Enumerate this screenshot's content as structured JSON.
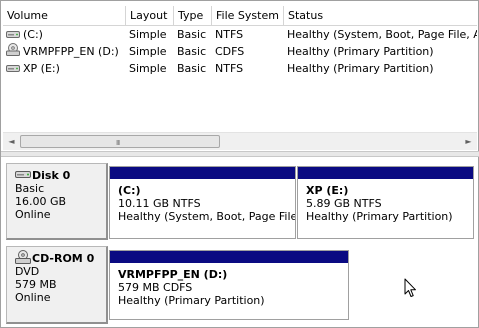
{
  "columns": [
    "Volume",
    "Layout",
    "Type",
    "File System",
    "Status"
  ],
  "volumes": [
    {
      "icon": "hard-disk-icon",
      "name": "(C:)",
      "layout": "Simple",
      "type": "Basic",
      "fs": "NTFS",
      "status": "Healthy (System, Boot, Page File, Ac"
    },
    {
      "icon": "cd-drive-icon",
      "name": "VRMPFPP_EN (D:)",
      "layout": "Simple",
      "type": "Basic",
      "fs": "CDFS",
      "status": "Healthy (Primary Partition)"
    },
    {
      "icon": "hard-disk-icon",
      "name": "XP (E:)",
      "layout": "Simple",
      "type": "Basic",
      "fs": "NTFS",
      "status": "Healthy (Primary Partition)"
    }
  ],
  "disks": [
    {
      "name": "Disk 0",
      "kind": "Basic",
      "size": "16.00 GB",
      "state": "Online",
      "partitions": [
        {
          "label": "(C:)",
          "size": "10.11 GB NTFS",
          "status": "Healthy (System, Boot, Page File,"
        },
        {
          "label": "XP  (E:)",
          "size": "5.89 GB NTFS",
          "status": "Healthy (Primary Partition)"
        }
      ]
    },
    {
      "name": "CD-ROM 0",
      "kind": "DVD",
      "size": "579 MB",
      "state": "Online",
      "partitions": [
        {
          "label": "VRMPFPP_EN  (D:)",
          "size": "579 MB CDFS",
          "status": "Healthy (Primary Partition)"
        }
      ]
    }
  ],
  "scrollbar": {
    "left_arrow": "◄",
    "right_arrow": "►",
    "grip": "III"
  },
  "colors": {
    "partition_bar": "#0a0a82",
    "disk_card": "#f0f0f0",
    "header_border": "#d5d5d5"
  }
}
